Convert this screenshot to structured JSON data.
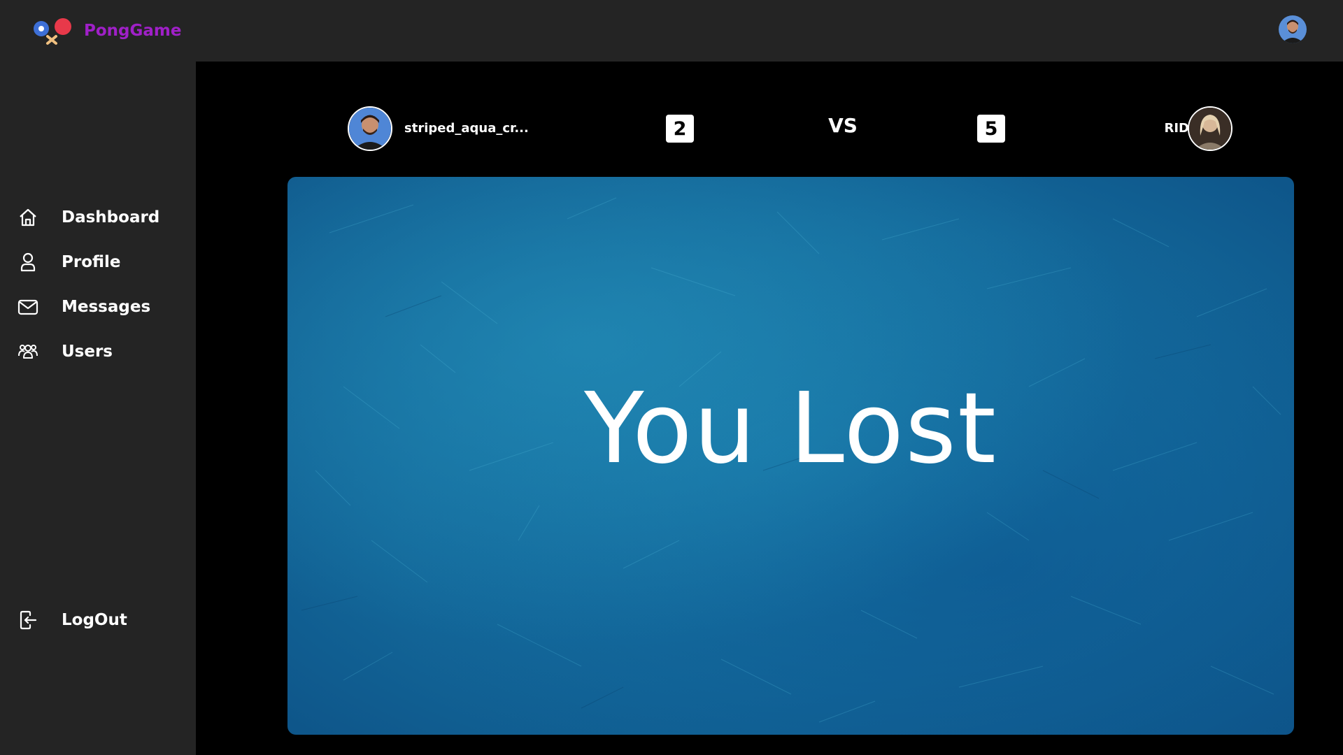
{
  "app": {
    "brand": "PongGame",
    "brand_color": "#a020c8",
    "logo_icon": "ping-pong-paddles-icon"
  },
  "header": {
    "avatar_icon": "user-avatar"
  },
  "sidebar": {
    "items": [
      {
        "label": "Dashboard",
        "icon": "home-icon"
      },
      {
        "label": "Profile",
        "icon": "user-icon"
      },
      {
        "label": "Messages",
        "icon": "mail-icon"
      },
      {
        "label": "Users",
        "icon": "users-icon"
      }
    ],
    "logout": {
      "label": "LogOut",
      "icon": "logout-icon"
    }
  },
  "match": {
    "player_left": {
      "name": "striped_aqua_cr...",
      "score": "2"
    },
    "vs": "VS",
    "player_right": {
      "name": "RID",
      "score": "5"
    },
    "result": "You Lost",
    "board_color": "#1572a3"
  }
}
